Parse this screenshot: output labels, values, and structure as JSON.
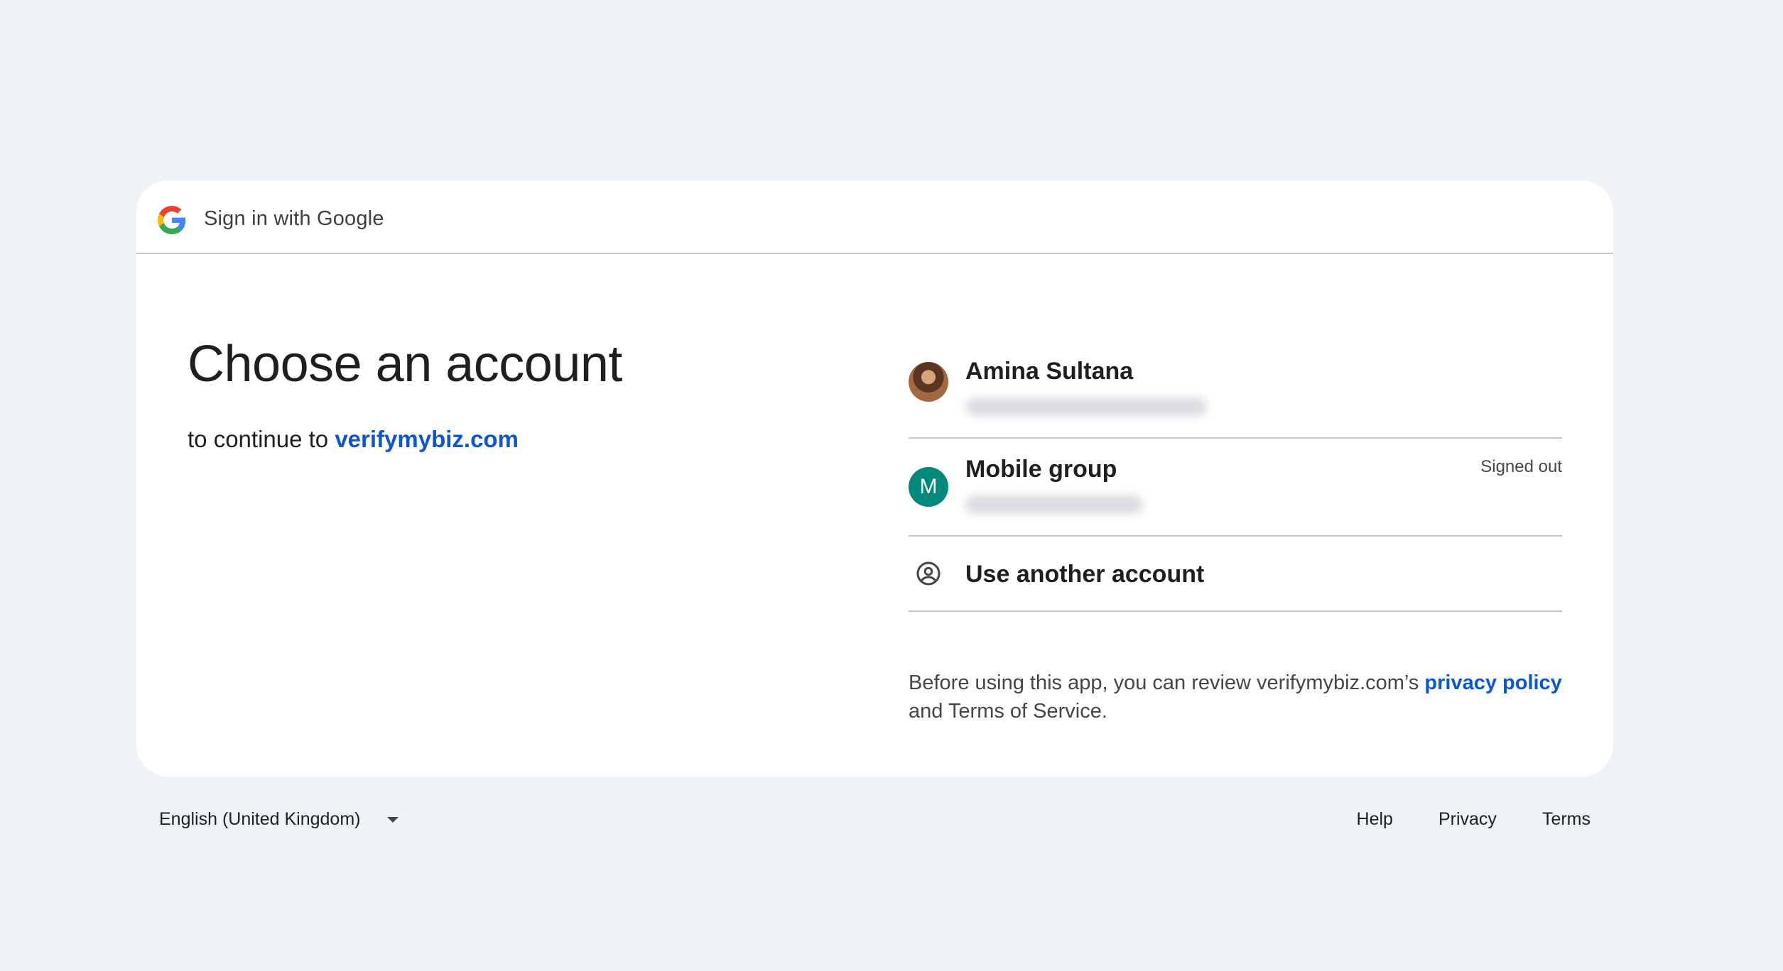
{
  "header": {
    "title": "Sign in with Google",
    "logo_icon": "google-g-icon"
  },
  "main": {
    "title": "Choose an account",
    "subtitle_prefix": "to continue to ",
    "subtitle_link": "verifymybiz.com"
  },
  "accounts": [
    {
      "name": "Amina Sultana",
      "avatar_type": "photo",
      "status": "",
      "email_blurred": true
    },
    {
      "name": "Mobile group",
      "avatar_type": "initial",
      "avatar_initial": "M",
      "avatar_color": "#00897b",
      "status": "Signed out",
      "email_blurred": true
    }
  ],
  "use_another": {
    "label": "Use another account",
    "icon": "account-circle-icon"
  },
  "disclaimer": {
    "text_before": "Before using this app, you can review verifymybiz.com’s ",
    "link": "privacy policy",
    "text_after": " and Terms of Service."
  },
  "footer": {
    "language": "English (United Kingdom)",
    "links": [
      "Help",
      "Privacy",
      "Terms"
    ]
  },
  "colors": {
    "background": "#eff3f8",
    "link": "#0b57d0",
    "divider": "#c4c7c5"
  }
}
